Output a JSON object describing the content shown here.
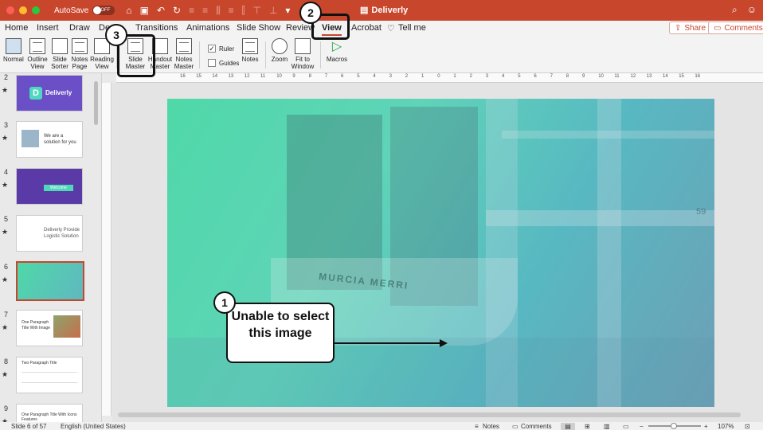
{
  "titlebar": {
    "autosave_label": "AutoSave",
    "autosave_state": "OFF",
    "doc_title": "Deliverly",
    "color": "#c8462c"
  },
  "tabs": [
    "Home",
    "Insert",
    "Draw",
    "De",
    "Transitions",
    "Animations",
    "Slide Show",
    "Review",
    "View",
    "Acrobat",
    "Tell me"
  ],
  "active_tab": "View",
  "share_label": "Share",
  "comments_label": "Comments",
  "ribbon": {
    "normal": "Normal",
    "outline_view": "Outline View",
    "slide_sorter": "Slide Sorter",
    "notes_page": "Notes Page",
    "reading_view": "Reading View",
    "slide_master": "Slide Master",
    "handout_master": "Handout Master",
    "notes_master": "Notes Master",
    "ruler": "Ruler",
    "guides": "Guides",
    "notes": "Notes",
    "zoom": "Zoom",
    "fit_to_window": "Fit to Window",
    "macros": "Macros"
  },
  "ruler_labels": [
    "16",
    "15",
    "14",
    "13",
    "12",
    "11",
    "10",
    "9",
    "8",
    "7",
    "6",
    "5",
    "4",
    "3",
    "2",
    "1",
    "0",
    "1",
    "2",
    "3",
    "4",
    "5",
    "6",
    "7",
    "8",
    "9",
    "10",
    "11",
    "12",
    "13",
    "14",
    "15",
    "16"
  ],
  "slides": [
    {
      "num": "2",
      "caption": "Deliverly"
    },
    {
      "num": "3",
      "caption": "We are a solution for you"
    },
    {
      "num": "4",
      "caption": "Welcome"
    },
    {
      "num": "5",
      "caption": "Deliverly Provide Logistic Solution"
    },
    {
      "num": "6",
      "caption": ""
    },
    {
      "num": "7",
      "caption": "One Paragraph Title With Image"
    },
    {
      "num": "8",
      "caption": "Two Paragraph Title"
    },
    {
      "num": "9",
      "caption": "One Paragraph Title With Icons Features"
    }
  ],
  "slide_content": {
    "ship_text": "MURCIA MERRI",
    "crane_number": "59"
  },
  "status": {
    "slide_info": "Slide 6 of 57",
    "language": "English (United States)",
    "notes": "Notes",
    "comments": "Comments",
    "zoom": "107%"
  },
  "annotations": {
    "badge1": "1",
    "badge2": "2",
    "badge3": "3",
    "callout_text": "Unable to select this image"
  }
}
